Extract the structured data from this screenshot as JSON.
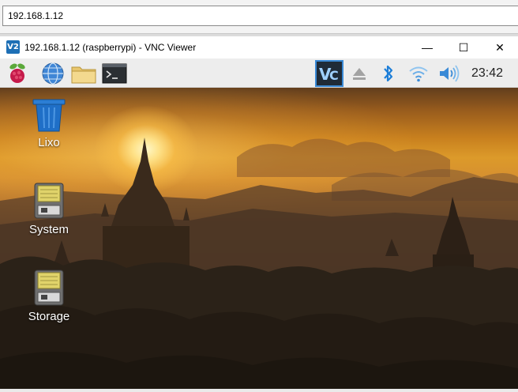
{
  "browser": {
    "address": "192.168.1.12"
  },
  "window": {
    "title": "192.168.1.12 (raspberrypi) - VNC Viewer",
    "app_logo": "V2",
    "minimize_glyph": "—",
    "maximize_glyph": "☐",
    "close_glyph": "✕"
  },
  "taskbar": {
    "clock": "23:42",
    "launchers": [
      "raspberry-menu-icon",
      "web-browser-icon",
      "file-manager-icon",
      "terminal-icon"
    ],
    "tray": [
      "vnc-server-icon",
      "eject-icon",
      "bluetooth-icon",
      "wifi-icon",
      "volume-icon"
    ]
  },
  "desktop": {
    "icons": [
      {
        "label": "Lixo",
        "icon": "trash-icon"
      },
      {
        "label": "System",
        "icon": "drive-icon"
      },
      {
        "label": "Storage",
        "icon": "drive-icon"
      }
    ]
  },
  "colors": {
    "vnc_blue": "#1d6fb5",
    "bluetooth_blue": "#1e7fd8",
    "trash_blue": "#1f6fc7"
  }
}
